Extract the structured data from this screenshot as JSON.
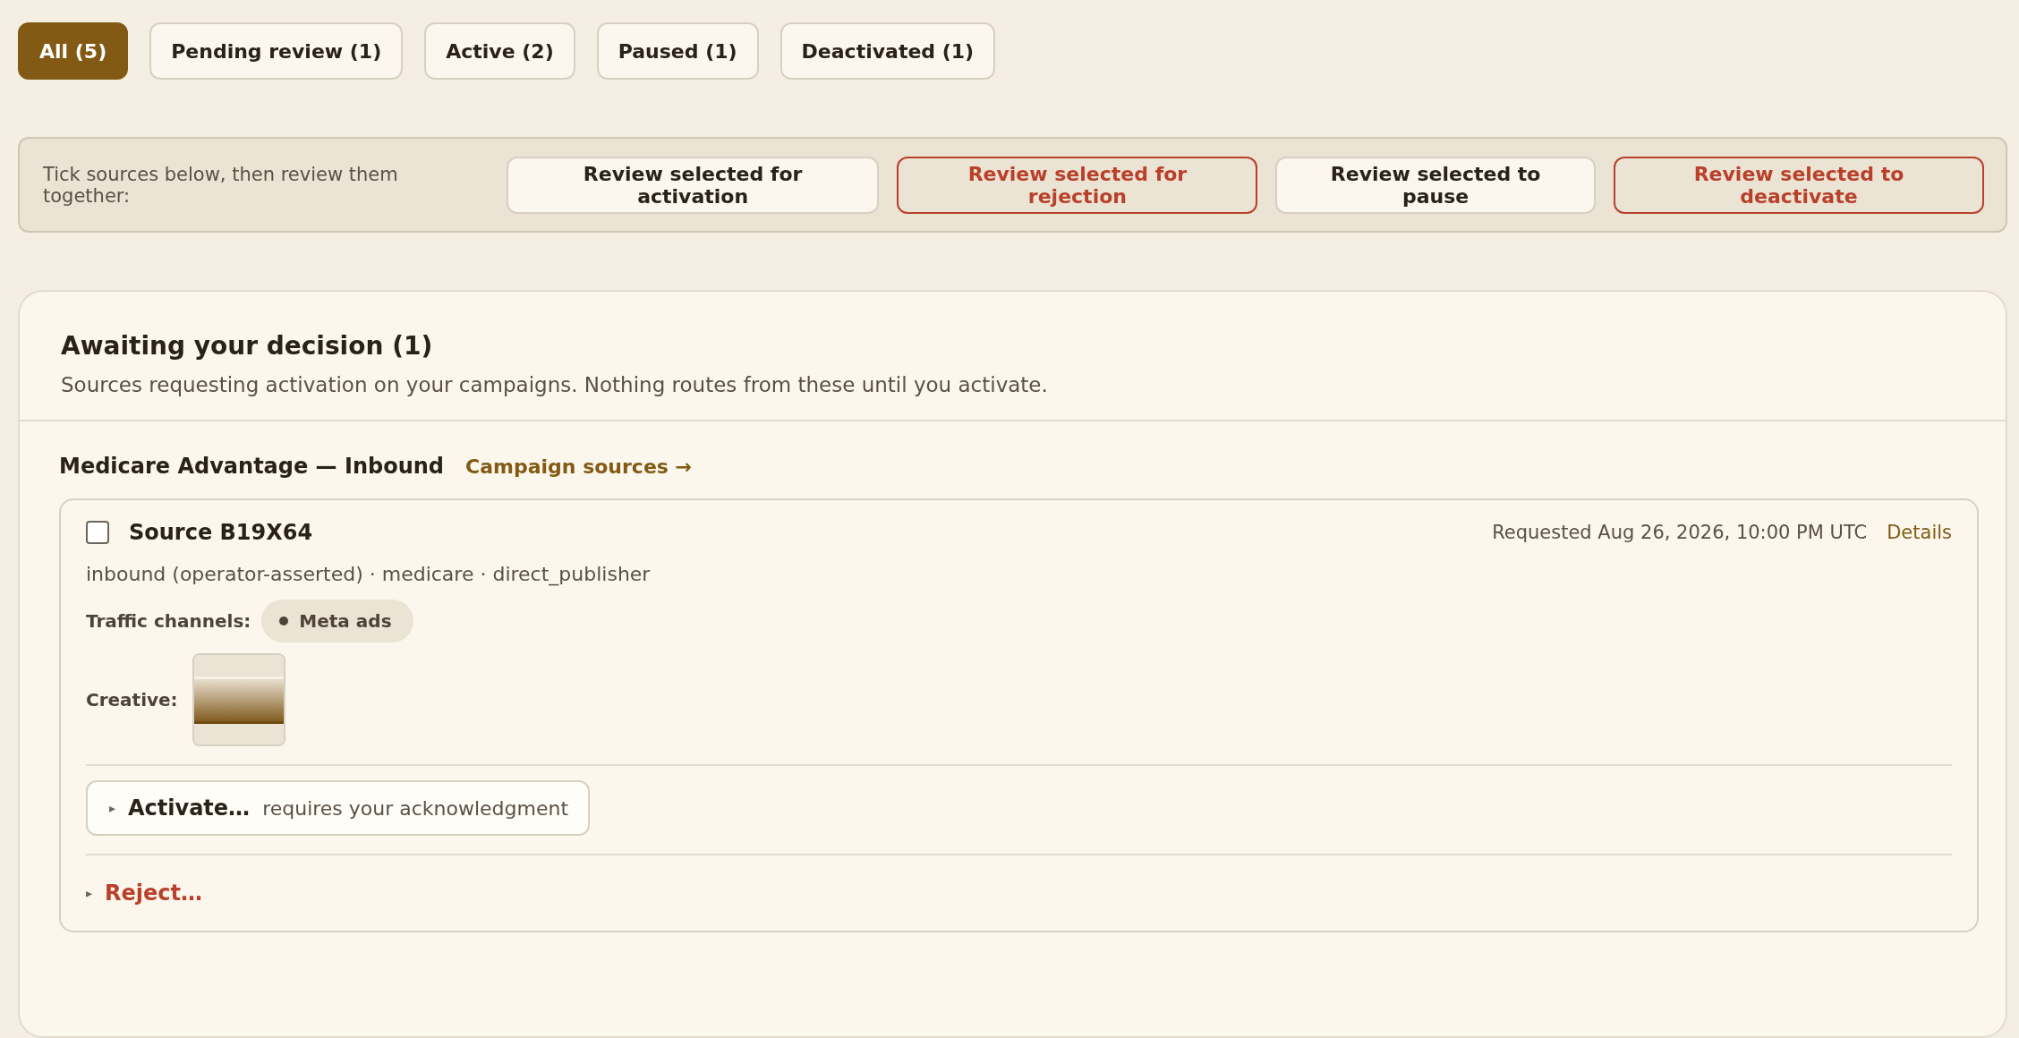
{
  "filter_tabs": [
    {
      "label": "All (5)",
      "selected": true
    },
    {
      "label": "Pending review (1)",
      "selected": false
    },
    {
      "label": "Active (2)",
      "selected": false
    },
    {
      "label": "Paused (1)",
      "selected": false
    },
    {
      "label": "Deactivated (1)",
      "selected": false
    }
  ],
  "bulk_bar": {
    "hint": "Tick sources below, then review them together:",
    "buttons": [
      {
        "label": "Review selected for activation",
        "kind": "primary"
      },
      {
        "label": "Review selected for rejection",
        "kind": "danger"
      },
      {
        "label": "Review selected to pause",
        "kind": "primary"
      },
      {
        "label": "Review selected to deactivate",
        "kind": "danger"
      }
    ]
  },
  "section": {
    "title": "Awaiting your decision (1)",
    "subtitle": "Sources requesting activation on your campaigns. Nothing routes from these until you activate.",
    "groups": [
      {
        "campaign": "Medicare Advantage — Inbound",
        "link": "Campaign sources →",
        "sources": [
          {
            "name": "Source B19X64",
            "checked": false,
            "requested": "Requested Aug 26, 2026, 10:00 PM UTC",
            "details_link": "Details",
            "meta": "inbound (operator-asserted) · medicare · direct_publisher",
            "channels_label": "Traffic channels:",
            "channels": [
              "Meta ads"
            ],
            "creative_label": "Creative:",
            "activate": {
              "marker": "▸",
              "label": "Activate…",
              "note": "requires your acknowledgment"
            },
            "reject": {
              "marker": "▸",
              "label": "Reject…"
            }
          }
        ]
      }
    ]
  }
}
